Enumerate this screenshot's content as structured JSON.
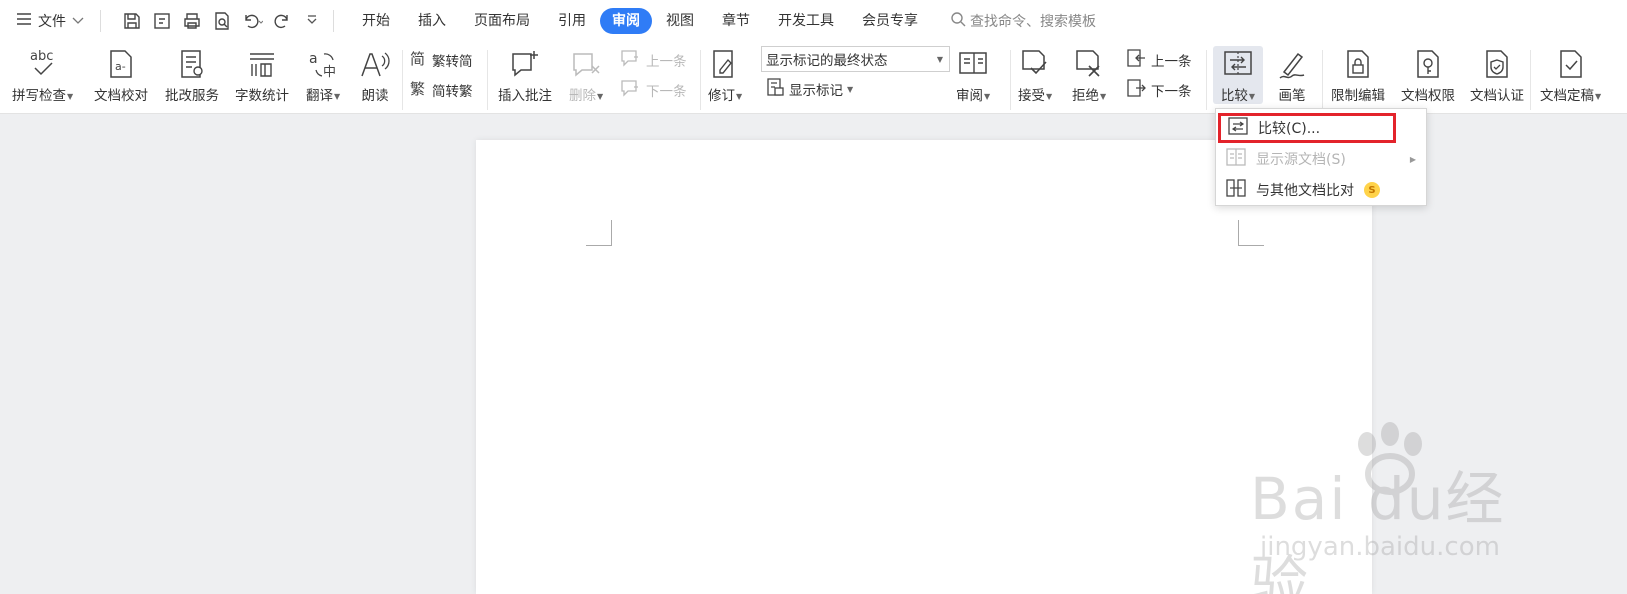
{
  "menubar": {
    "file_label": "文件",
    "tabs": [
      {
        "label": "开始",
        "active": false
      },
      {
        "label": "插入",
        "active": false
      },
      {
        "label": "页面布局",
        "active": false
      },
      {
        "label": "引用",
        "active": false
      },
      {
        "label": "审阅",
        "active": true
      },
      {
        "label": "视图",
        "active": false
      },
      {
        "label": "章节",
        "active": false
      },
      {
        "label": "开发工具",
        "active": false
      },
      {
        "label": "会员专享",
        "active": false
      }
    ],
    "search_placeholder": "查找命令、搜索模板",
    "accent": "#2f7cf6"
  },
  "ribbon": {
    "spell_check": "拼写检查",
    "doc_proof": "文档校对",
    "revise_service": "批改服务",
    "word_count": "字数统计",
    "translate": "翻译",
    "read_aloud": "朗读",
    "trad_to_simp": "繁转简",
    "simp_to_trad": "简转繁",
    "insert_comment": "插入批注",
    "delete": "删除",
    "prev_comment": "上一条",
    "next_comment": "下一条",
    "track_changes": "修订",
    "display_state": "显示标记的最终状态",
    "show_markup": "显示标记",
    "review": "审阅",
    "accept": "接受",
    "reject": "拒绝",
    "prev_change": "上一条",
    "next_change": "下一条",
    "compare": "比较",
    "pen": "画笔",
    "restrict_edit": "限制编辑",
    "doc_rights": "文档权限",
    "doc_certify": "文档认证",
    "doc_finalize": "文档定稿"
  },
  "compare_menu": {
    "items": [
      {
        "label": "比较(C)...",
        "highlighted": true,
        "disabled": false,
        "icon": "compare-icon"
      },
      {
        "label": "显示源文档(S)",
        "highlighted": false,
        "disabled": true,
        "icon": "source-doc-icon"
      },
      {
        "label": "与其他文档比对",
        "highlighted": false,
        "disabled": false,
        "icon": "doc-compare-icon",
        "badge": "S"
      }
    ],
    "highlight_color": "#e3232b"
  },
  "watermark": {
    "brand": "Bai  du经验",
    "url": "jingyan.baidu.com"
  }
}
